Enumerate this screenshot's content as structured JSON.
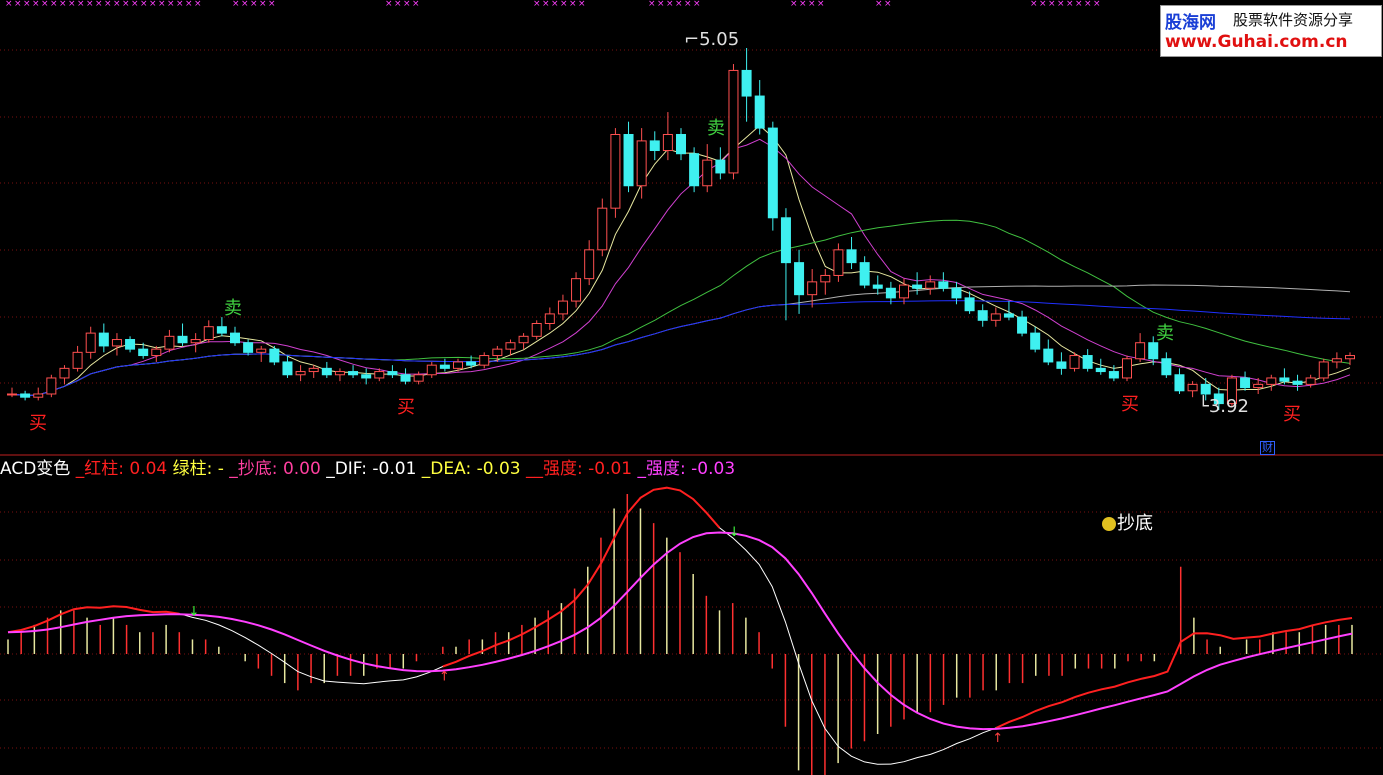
{
  "watermark": {
    "brand_cn": "股海网",
    "slogan": "股票软件资源分享",
    "url": "www.Guhai.com.cn"
  },
  "colors": {
    "background": "#000000",
    "up_candle": "#ff5050",
    "down_candle": "#3ff0f0",
    "ma5": "#e8e8a0",
    "ma10": "#d040d0",
    "ma30": "#40c040",
    "ma60": "#b0b0b0",
    "ma120": "#2030ff",
    "grid": "#7a1010",
    "dif": "#ffffff",
    "dea": "#ffff40",
    "red_line": "#ff2020",
    "magenta_line": "#ff40ff",
    "buy_text": "#ff2020",
    "sell_text": "#40d040",
    "up_arrow": "#ff4040",
    "down_arrow": "#40ff40"
  },
  "price_panel": {
    "high_label": "5.05",
    "low_label": "3.92",
    "signals": [
      {
        "text": "买",
        "type": "buy",
        "x": 38
      },
      {
        "text": "卖",
        "type": "sell",
        "x": 233
      },
      {
        "text": "买",
        "type": "buy",
        "x": 406
      },
      {
        "text": "卖",
        "type": "sell",
        "x": 716
      },
      {
        "text": "买",
        "type": "buy",
        "x": 1130
      },
      {
        "text": "卖",
        "type": "sell",
        "x": 1165
      },
      {
        "text": "买",
        "type": "buy",
        "x": 1292
      }
    ],
    "finance_badge": "财"
  },
  "indicator_panel": {
    "legend": [
      {
        "text": "ACD变色 ",
        "color": "#ffffff"
      },
      {
        "text": "_红柱: ",
        "color": "#ff2020"
      },
      {
        "text": "0.04 ",
        "color": "#ff2020"
      },
      {
        "text": "绿柱: ",
        "color": "#ffff40"
      },
      {
        "text": "- ",
        "color": "#ffff40"
      },
      {
        "text": "_抄底: ",
        "color": "#ff40a0"
      },
      {
        "text": "0.00 ",
        "color": "#ff40a0"
      },
      {
        "text": "_DIF: ",
        "color": "#ffffff"
      },
      {
        "text": "-0.01 ",
        "color": "#ffffff"
      },
      {
        "text": "_DEA: ",
        "color": "#ffff40"
      },
      {
        "text": "-0.03 ",
        "color": "#ffff40"
      },
      {
        "text": "__强度: ",
        "color": "#ff2020"
      },
      {
        "text": "-0.01 ",
        "color": "#ff2020"
      },
      {
        "text": "_强度: ",
        "color": "#ff40ff"
      },
      {
        "text": "-0.03",
        "color": "#ff40ff"
      }
    ],
    "bottom_label": "抄底"
  },
  "chart_data": [
    {
      "type": "candlestick",
      "series": "price",
      "high": 5.05,
      "low": 3.92,
      "ohlc": [
        [
          3.97,
          3.99,
          3.96,
          3.97
        ],
        [
          3.97,
          3.98,
          3.95,
          3.96
        ],
        [
          3.96,
          3.99,
          3.95,
          3.97
        ],
        [
          3.97,
          4.03,
          3.96,
          4.02
        ],
        [
          4.02,
          4.06,
          4.0,
          4.05
        ],
        [
          4.05,
          4.12,
          4.04,
          4.1
        ],
        [
          4.1,
          4.18,
          4.08,
          4.16
        ],
        [
          4.16,
          4.19,
          4.1,
          4.12
        ],
        [
          4.12,
          4.16,
          4.09,
          4.14
        ],
        [
          4.14,
          4.15,
          4.1,
          4.11
        ],
        [
          4.11,
          4.13,
          4.08,
          4.09
        ],
        [
          4.09,
          4.12,
          4.07,
          4.11
        ],
        [
          4.11,
          4.17,
          4.1,
          4.15
        ],
        [
          4.15,
          4.19,
          4.12,
          4.13
        ],
        [
          4.13,
          4.16,
          4.1,
          4.14
        ],
        [
          4.14,
          4.2,
          4.13,
          4.18
        ],
        [
          4.18,
          4.21,
          4.15,
          4.16
        ],
        [
          4.16,
          4.18,
          4.12,
          4.13
        ],
        [
          4.13,
          4.14,
          4.09,
          4.1
        ],
        [
          4.1,
          4.12,
          4.07,
          4.11
        ],
        [
          4.11,
          4.12,
          4.06,
          4.07
        ],
        [
          4.07,
          4.09,
          4.02,
          4.03
        ],
        [
          4.03,
          4.06,
          4.01,
          4.04
        ],
        [
          4.04,
          4.06,
          4.02,
          4.05
        ],
        [
          4.05,
          4.07,
          4.02,
          4.03
        ],
        [
          4.03,
          4.05,
          4.01,
          4.04
        ],
        [
          4.04,
          4.06,
          4.02,
          4.03
        ],
        [
          4.03,
          4.05,
          4.0,
          4.02
        ],
        [
          4.02,
          4.05,
          4.01,
          4.04
        ],
        [
          4.04,
          4.06,
          4.02,
          4.03
        ],
        [
          4.03,
          4.05,
          4.0,
          4.01
        ],
        [
          4.01,
          4.04,
          4.0,
          4.03
        ],
        [
          4.03,
          4.07,
          4.02,
          4.06
        ],
        [
          4.06,
          4.08,
          4.04,
          4.05
        ],
        [
          4.05,
          4.08,
          4.04,
          4.07
        ],
        [
          4.07,
          4.09,
          4.05,
          4.06
        ],
        [
          4.06,
          4.1,
          4.05,
          4.09
        ],
        [
          4.09,
          4.12,
          4.07,
          4.11
        ],
        [
          4.11,
          4.14,
          4.09,
          4.13
        ],
        [
          4.13,
          4.16,
          4.11,
          4.15
        ],
        [
          4.15,
          4.2,
          4.14,
          4.19
        ],
        [
          4.19,
          4.24,
          4.17,
          4.22
        ],
        [
          4.22,
          4.28,
          4.2,
          4.26
        ],
        [
          4.26,
          4.35,
          4.24,
          4.33
        ],
        [
          4.33,
          4.45,
          4.31,
          4.42
        ],
        [
          4.42,
          4.58,
          4.4,
          4.55
        ],
        [
          4.55,
          4.8,
          4.52,
          4.78
        ],
        [
          4.78,
          4.82,
          4.6,
          4.62
        ],
        [
          4.62,
          4.8,
          4.58,
          4.76
        ],
        [
          4.76,
          4.79,
          4.7,
          4.73
        ],
        [
          4.73,
          4.85,
          4.7,
          4.78
        ],
        [
          4.78,
          4.8,
          4.7,
          4.72
        ],
        [
          4.72,
          4.74,
          4.6,
          4.62
        ],
        [
          4.62,
          4.75,
          4.6,
          4.7
        ],
        [
          4.7,
          4.74,
          4.64,
          4.66
        ],
        [
          4.66,
          5.0,
          4.64,
          4.98
        ],
        [
          4.98,
          5.05,
          4.82,
          4.9
        ],
        [
          4.9,
          4.95,
          4.78,
          4.8
        ],
        [
          4.8,
          4.82,
          4.48,
          4.52
        ],
        [
          4.52,
          4.55,
          4.2,
          4.38
        ],
        [
          4.38,
          4.42,
          4.22,
          4.28
        ],
        [
          4.28,
          4.36,
          4.24,
          4.32
        ],
        [
          4.32,
          4.36,
          4.28,
          4.34
        ],
        [
          4.34,
          4.44,
          4.32,
          4.42
        ],
        [
          4.42,
          4.46,
          4.36,
          4.38
        ],
        [
          4.38,
          4.4,
          4.3,
          4.31
        ],
        [
          4.31,
          4.34,
          4.28,
          4.3
        ],
        [
          4.3,
          4.32,
          4.25,
          4.27
        ],
        [
          4.27,
          4.33,
          4.25,
          4.31
        ],
        [
          4.31,
          4.35,
          4.28,
          4.3
        ],
        [
          4.3,
          4.34,
          4.28,
          4.32
        ],
        [
          4.32,
          4.35,
          4.29,
          4.3
        ],
        [
          4.3,
          4.32,
          4.25,
          4.27
        ],
        [
          4.27,
          4.29,
          4.22,
          4.23
        ],
        [
          4.23,
          4.25,
          4.18,
          4.2
        ],
        [
          4.2,
          4.24,
          4.18,
          4.22
        ],
        [
          4.22,
          4.26,
          4.2,
          4.21
        ],
        [
          4.21,
          4.23,
          4.15,
          4.16
        ],
        [
          4.16,
          4.18,
          4.1,
          4.11
        ],
        [
          4.11,
          4.14,
          4.06,
          4.07
        ],
        [
          4.07,
          4.1,
          4.03,
          4.05
        ],
        [
          4.05,
          4.1,
          4.04,
          4.09
        ],
        [
          4.09,
          4.11,
          4.04,
          4.05
        ],
        [
          4.05,
          4.08,
          4.03,
          4.04
        ],
        [
          4.04,
          4.06,
          4.01,
          4.02
        ],
        [
          4.02,
          4.09,
          4.01,
          4.08
        ],
        [
          4.08,
          4.16,
          4.07,
          4.13
        ],
        [
          4.13,
          4.15,
          4.06,
          4.08
        ],
        [
          4.08,
          4.1,
          4.02,
          4.03
        ],
        [
          4.03,
          4.05,
          3.97,
          3.98
        ],
        [
          3.98,
          4.01,
          3.96,
          4.0
        ],
        [
          4.0,
          4.02,
          3.95,
          3.97
        ],
        [
          3.97,
          3.99,
          3.92,
          3.94
        ],
        [
          3.94,
          4.03,
          3.93,
          4.02
        ],
        [
          4.02,
          4.04,
          3.98,
          3.99
        ],
        [
          3.99,
          4.02,
          3.97,
          4.0
        ],
        [
          4.0,
          4.03,
          3.98,
          4.02
        ],
        [
          4.02,
          4.05,
          4.0,
          4.01
        ],
        [
          4.01,
          4.03,
          3.98,
          4.0
        ],
        [
          4.0,
          4.03,
          3.99,
          4.02
        ],
        [
          4.02,
          4.08,
          4.01,
          4.07
        ],
        [
          4.07,
          4.1,
          4.05,
          4.08
        ],
        [
          4.08,
          4.1,
          4.06,
          4.09
        ]
      ]
    },
    {
      "type": "bar",
      "series": "macd-histogram",
      "values": [
        0.02,
        0.03,
        0.04,
        0.05,
        0.06,
        0.06,
        0.05,
        0.04,
        0.05,
        0.04,
        0.03,
        0.03,
        0.04,
        0.03,
        0.02,
        0.02,
        0.01,
        0.0,
        -0.01,
        -0.02,
        -0.03,
        -0.04,
        -0.05,
        -0.04,
        -0.04,
        -0.03,
        -0.03,
        -0.03,
        -0.02,
        -0.02,
        -0.02,
        -0.01,
        0.0,
        0.01,
        0.01,
        0.02,
        0.02,
        0.03,
        0.03,
        0.04,
        0.05,
        0.06,
        0.07,
        0.09,
        0.12,
        0.16,
        0.2,
        0.22,
        0.2,
        0.18,
        0.16,
        0.14,
        0.11,
        0.08,
        0.06,
        0.07,
        0.05,
        0.03,
        -0.02,
        -0.1,
        -0.16,
        -0.18,
        -0.17,
        -0.15,
        -0.13,
        -0.12,
        -0.11,
        -0.1,
        -0.09,
        -0.08,
        -0.08,
        -0.07,
        -0.06,
        -0.06,
        -0.05,
        -0.05,
        -0.04,
        -0.04,
        -0.03,
        -0.03,
        -0.03,
        -0.02,
        -0.02,
        -0.02,
        -0.02,
        -0.01,
        -0.01,
        -0.01,
        0.0,
        0.12,
        0.05,
        0.02,
        0.01,
        0.0,
        0.02,
        0.02,
        0.03,
        0.03,
        0.03,
        0.04,
        0.04,
        0.04,
        0.04
      ]
    }
  ]
}
